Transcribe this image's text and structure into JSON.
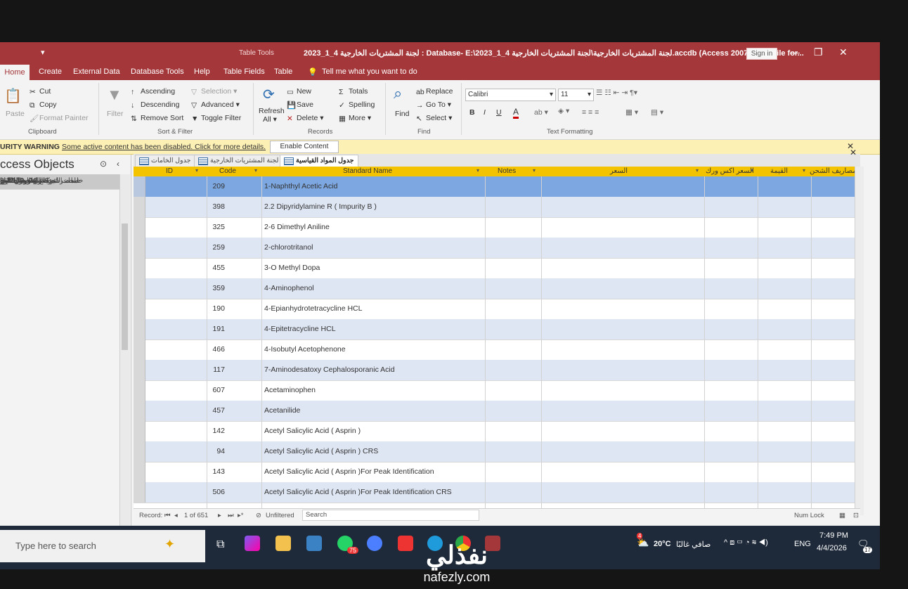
{
  "title_bar": {
    "qat": "▾",
    "table_tools": "Table Tools",
    "window_title": "2023_1_4 لجنة المشتريات الخارجية : Database- E:\\2023_1_4 لجنة المشتريات الخارجية\\لجنة المشتريات الخارجية.accdb (Access 2007 - 2016 file for...",
    "sign_in": "Sign in",
    "minimize": "—",
    "restore": "❐",
    "close": "✕"
  },
  "menu_tabs": [
    "Home",
    "Create",
    "External Data",
    "Database Tools",
    "Help",
    "Table Fields",
    "Table"
  ],
  "tell_me": "Tell me what you want to do",
  "ribbon": {
    "clipboard": {
      "paste": "Paste",
      "cut": "Cut",
      "copy": "Copy",
      "format_painter": "Format Painter",
      "group": "Clipboard"
    },
    "sort_filter": {
      "filter": "Filter",
      "ascending": "Ascending",
      "descending": "Descending",
      "remove_sort": "Remove Sort",
      "selection": "Selection",
      "advanced": "Advanced",
      "toggle_filter": "Toggle Filter",
      "group": "Sort & Filter"
    },
    "records": {
      "refresh": "Refresh",
      "refresh_all": "All",
      "new": "New",
      "save": "Save",
      "delete": "Delete",
      "totals": "Totals",
      "spelling": "Spelling",
      "more": "More",
      "group": "Records"
    },
    "find": {
      "find": "Find",
      "replace": "Replace",
      "go_to": "Go To",
      "select": "Select",
      "group": "Find"
    },
    "text_formatting": {
      "font": "Calibri",
      "size": "11",
      "bold": "B",
      "italic": "I",
      "underline": "U",
      "font_color": "A",
      "group": "Text Formatting"
    }
  },
  "security_bar": {
    "label": "URITY WARNING",
    "message": "Some active content has been disabled. Click for more details.",
    "button": "Enable Content",
    "close": "✕"
  },
  "nav_pane": {
    "title": "ccess Objects",
    "items": [
      {
        "label": "ارصدة الخامات الراكدة فى 30 / 6 / 9"
      },
      {
        "label": "الخامات الراكدة حتى 30 / 6 / 9"
      },
      {
        "label": "الخامات الراكدة حتى 31 / 12 / 8"
      },
      {
        "label": "الخامات الراكدة حتى 31 / 12 / 9"
      },
      {
        "label": "الخامات الراكدة فى 31 / 3 / 9"
      },
      {
        "label": "الخامات الفعالة والمستحضرات لشركة"
      },
      {
        "label": "الخامات بطيئة الحركة التى سوف يتم"
      },
      {
        "label": "الـ"
      },
      {
        "label": "الشركات المصنعة للخا"
      },
      {
        "label": "الشركات و الجهات الم"
      },
      {
        "label": "العـ"
      },
      {
        "label": "المواد"
      },
      {
        "label": "جدول الخا"
      },
      {
        "label": "جدول المستلز"
      },
      {
        "label": "جدول المشتريات الخارجية للمواد القيا"
      },
      {
        "label": "جدول المواد القيا"
      },
      {
        "label": "جدول المو"
      },
      {
        "label": "جدول الوح"
      },
      {
        "label": "خامات الشركة العربية الاسك"
      },
      {
        "label": "خامات شركة القاهرة الاسك"
      },
      {
        "label": "شروط التس"
      },
      {
        "label": "لجنة المشتريات الخا"
      },
      {
        "label": "محضر 24 -19-12-8"
      },
      {
        "label": "محضر اجتماع _1 _9_10_8"
      }
    ],
    "selected_index": 15
  },
  "doc_tabs": [
    {
      "label": "جدول الخامات"
    },
    {
      "label": "لجنة المشتريات الخارجية"
    },
    {
      "label": "جدول المواد القياسية"
    }
  ],
  "grid": {
    "columns": [
      "ID",
      "Code",
      "Standard Name",
      "Notes",
      "السعر",
      "السعر اكس ورك",
      "القيمة",
      "مصاريف الشحن"
    ],
    "rows": [
      {
        "id": "209",
        "name": "1-Naphthyl Acetic Acid"
      },
      {
        "id": "398",
        "name": "2.2 Dipyridylamine R ( Impurity B )"
      },
      {
        "id": "325",
        "name": "2-6 Dimethyl Aniline"
      },
      {
        "id": "259",
        "name": "2-chlorotritanol"
      },
      {
        "id": "455",
        "name": "3-O Methyl Dopa"
      },
      {
        "id": "359",
        "name": "4-Aminophenol"
      },
      {
        "id": "190",
        "name": "4-Epianhydrotetracycline HCL"
      },
      {
        "id": "191",
        "name": "4-Epitetracycline HCL"
      },
      {
        "id": "466",
        "name": "4-Isobutyl Acetophenone"
      },
      {
        "id": "117",
        "name": "7-Aminodesatoxy Cephalosporanic Acid"
      },
      {
        "id": "607",
        "name": "Acetaminophen"
      },
      {
        "id": "457",
        "name": "Acetanilide"
      },
      {
        "id": "142",
        "name": "Acetyl Salicylic Acid ( Asprin )"
      },
      {
        "id": "94",
        "name": "Acetyl Salicylic Acid ( Asprin ) CRS"
      },
      {
        "id": "143",
        "name": "Acetyl Salicylic Acid ( Asprin )For Peak Identification"
      },
      {
        "id": "506",
        "name": "Acetyl Salicylic Acid ( Asprin )For Peak Identification CRS"
      }
    ]
  },
  "record_nav": {
    "label": "Record:",
    "position": "1 of 651",
    "filter": "Unfiltered",
    "search": "Search",
    "num_lock": "Num Lock"
  },
  "taskbar": {
    "search_placeholder": "Type here to search",
    "whatsapp_badge": "75",
    "weather": "20°C",
    "weather_text": "صافي غالبًا",
    "lang": "ENG",
    "time": "7:49 PM",
    "date": "4/4/2026",
    "notif_count": "17",
    "weather_badge": "4"
  },
  "watermark": {
    "brand": "نفذلي",
    "domain": "nafezly.com"
  },
  "colors": {
    "access_red": "#a4373a",
    "header_yellow": "#f4c300",
    "alt_row": "#dfe6f3",
    "selected_row": "#7da7e0",
    "warning_bg": "#fdf0b5"
  }
}
